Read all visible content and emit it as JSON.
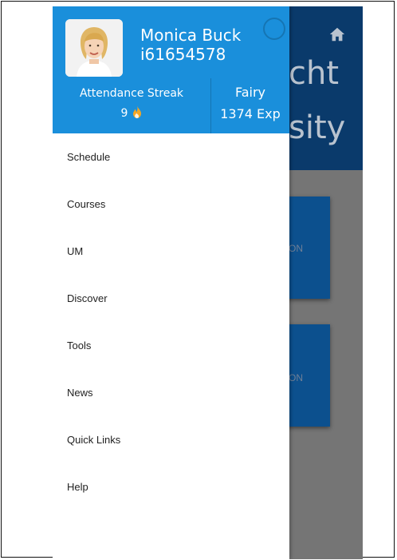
{
  "background": {
    "title_line1": "cht",
    "title_line2": "sity",
    "card1_label": "ON",
    "card2_label": "ON",
    "home_icon": "home-icon"
  },
  "drawer": {
    "user": {
      "name": "Monica Buck",
      "id": "i61654578"
    },
    "stats": {
      "streak_label": "Attendance Streak",
      "streak_value": "9",
      "streak_icon": "flame-icon",
      "rank": "Fairy",
      "exp": "1374 Exp"
    },
    "menu": [
      {
        "label": "Schedule"
      },
      {
        "label": "Courses"
      },
      {
        "label": "UM"
      },
      {
        "label": "Discover"
      },
      {
        "label": "Tools"
      },
      {
        "label": "News"
      },
      {
        "label": "Quick Links"
      },
      {
        "label": "Help"
      }
    ]
  },
  "colors": {
    "header_blue": "#1a8fdb",
    "app_navy": "#0a3a6b",
    "card_blue": "#0c508e",
    "scrim": "#757575",
    "flame": "#f5a623"
  }
}
